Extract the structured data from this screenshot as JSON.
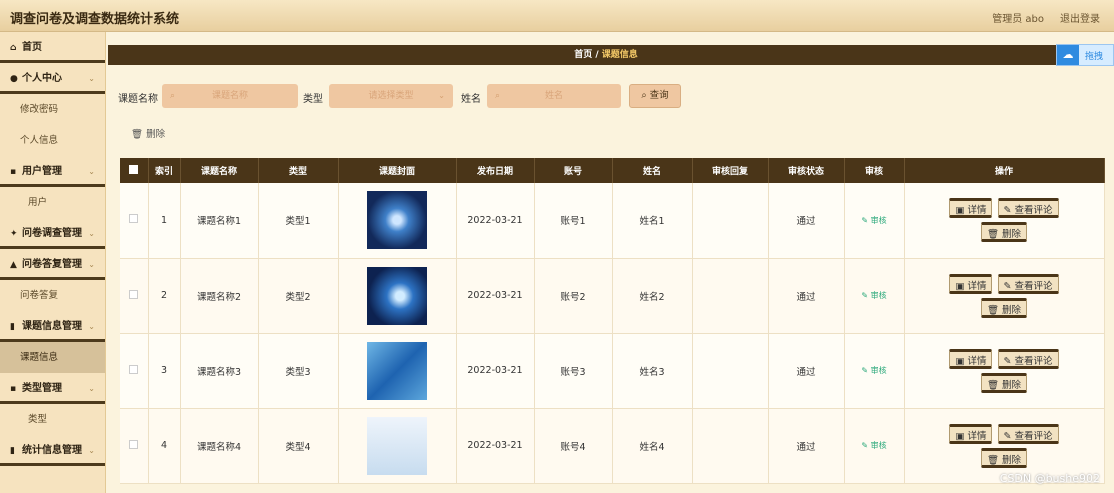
{
  "app": {
    "title": "调查问卷及调查数据统计系统",
    "user": "管理员 abo",
    "logout": "退出登录"
  },
  "sidebar": {
    "items": [
      {
        "label": "首页",
        "icon": "home-icon"
      },
      {
        "label": "个人中心",
        "icon": "user-icon"
      },
      {
        "label": "修改密码",
        "sub": true
      },
      {
        "label": "个人信息",
        "sub": true
      },
      {
        "label": "用户管理",
        "icon": "grid-icon"
      },
      {
        "label": "用户",
        "sub": true
      },
      {
        "label": "问卷调查管理",
        "icon": "gear-icon"
      },
      {
        "label": "问卷答复管理",
        "icon": "lock-icon"
      },
      {
        "label": "问卷答复",
        "sub": true
      },
      {
        "label": "课题信息管理",
        "icon": "list-icon"
      },
      {
        "label": "课题信息",
        "sub": true,
        "active": true
      },
      {
        "label": "类型管理",
        "icon": "grid-icon"
      },
      {
        "label": "类型",
        "sub": true
      },
      {
        "label": "统计信息管理",
        "icon": "list-icon"
      }
    ]
  },
  "breadcrumb": {
    "home": "首页",
    "sep": "/",
    "current": "课题信息"
  },
  "cloud": {
    "label": "拖拽"
  },
  "search": {
    "name_label": "课题名称",
    "name_placeholder": "课题名称",
    "type_label": "类型",
    "type_placeholder": "请选择类型",
    "person_label": "姓名",
    "person_placeholder": "姓名",
    "query_label": "查询"
  },
  "delete_link": "删除",
  "table": {
    "headers": [
      "",
      "索引",
      "课题名称",
      "类型",
      "课题封面",
      "发布日期",
      "账号",
      "姓名",
      "审核回复",
      "审核状态",
      "审核",
      "操作"
    ],
    "rows": [
      {
        "index": "1",
        "name": "课题名称1",
        "type": "类型1",
        "date": "2022-03-21",
        "account": "账号1",
        "person": "姓名1",
        "reply": "",
        "status": "通过",
        "audit": "审核"
      },
      {
        "index": "2",
        "name": "课题名称2",
        "type": "类型2",
        "date": "2022-03-21",
        "account": "账号2",
        "person": "姓名2",
        "reply": "",
        "status": "通过",
        "audit": "审核"
      },
      {
        "index": "3",
        "name": "课题名称3",
        "type": "类型3",
        "date": "2022-03-21",
        "account": "账号3",
        "person": "姓名3",
        "reply": "",
        "status": "通过",
        "audit": "审核"
      },
      {
        "index": "4",
        "name": "课题名称4",
        "type": "类型4",
        "date": "2022-03-21",
        "account": "账号4",
        "person": "姓名4",
        "reply": "",
        "status": "通过",
        "audit": "审核"
      }
    ],
    "ops": {
      "detail": "详情",
      "comments": "查看评论",
      "delete": "删除"
    }
  },
  "watermark": "CSDN @bushe902"
}
